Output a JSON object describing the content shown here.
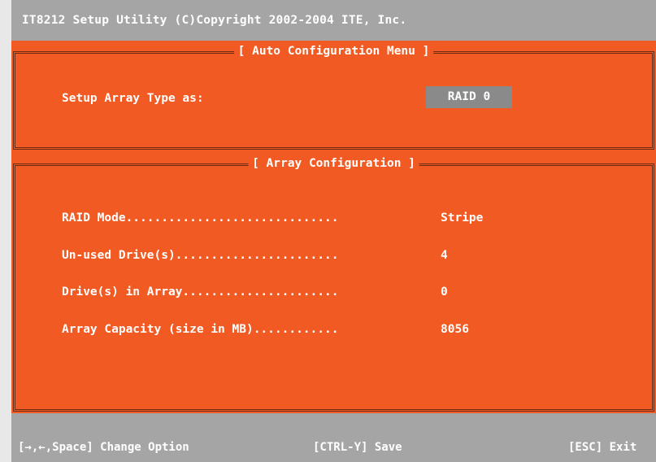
{
  "title_bar": {
    "text": "IT8212 Setup Utility (C)Copyright 2002-2004 ITE, Inc."
  },
  "auto_config": {
    "title": "[ Auto Configuration Menu ]",
    "setup_label": "Setup Array Type as:",
    "array_type_value": "RAID 0"
  },
  "array_config": {
    "title": "[ Array Configuration ]",
    "rows": [
      {
        "label": "RAID Mode..............................",
        "value": "Stripe"
      },
      {
        "label": "Un-used Drive(s).......................",
        "value": "4"
      },
      {
        "label": "Drive(s) in Array......................",
        "value": "0"
      },
      {
        "label": "Array Capacity (size in MB)............",
        "value": "8056"
      }
    ]
  },
  "footer": {
    "change_option": "[→,←,Space] Change Option",
    "save": "[CTRL-Y] Save",
    "exit": "[ESC] Exit"
  },
  "colors": {
    "panel_bg": "#f15a22",
    "bar_bg": "#a5a5a5",
    "text": "#ffffff",
    "selected_bg": "#8a8a8a"
  }
}
